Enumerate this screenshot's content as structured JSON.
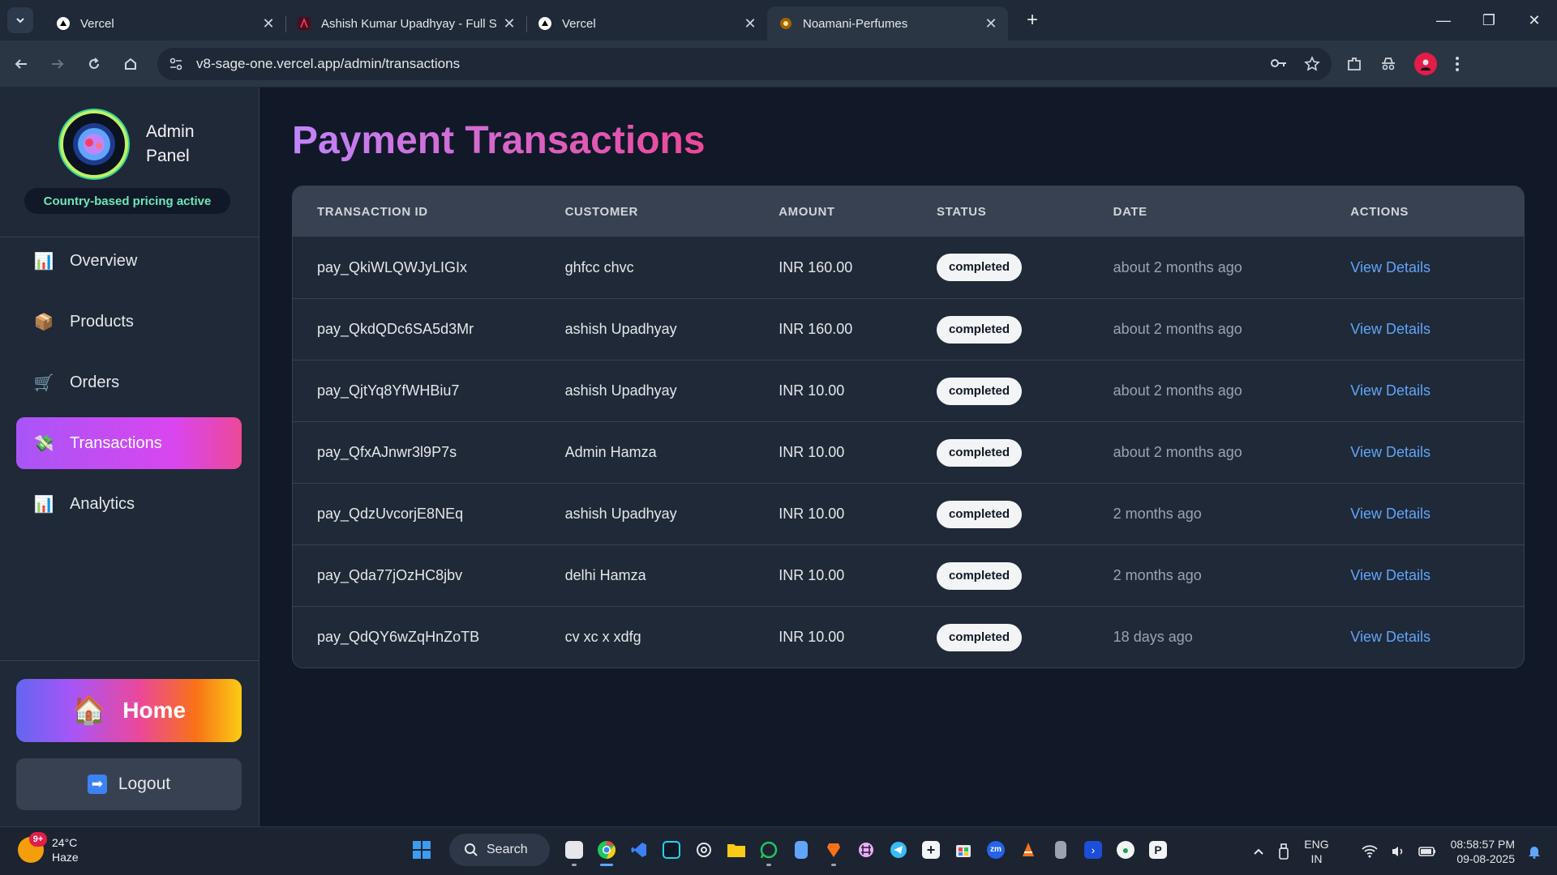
{
  "browser": {
    "tabs": [
      {
        "title": "Vercel",
        "favicon": "vercel-triangle",
        "active": false
      },
      {
        "title": "Ashish Kumar Upadhyay - Full S",
        "favicon": "ak-logo",
        "active": false
      },
      {
        "title": "Vercel",
        "favicon": "vercel-triangle",
        "active": false
      },
      {
        "title": "Noamani-Perfumes",
        "favicon": "perfume-logo",
        "active": true
      }
    ],
    "url": "v8-sage-one.vercel.app/admin/transactions"
  },
  "sidebar": {
    "brand_title": "Admin Panel",
    "pricing_note": "Country-based pricing active",
    "items": [
      {
        "label": "Overview",
        "icon": "bar-chart-icon",
        "glyph": "📊"
      },
      {
        "label": "Products",
        "icon": "package-icon",
        "glyph": "📦"
      },
      {
        "label": "Orders",
        "icon": "cart-icon",
        "glyph": "🛒"
      },
      {
        "label": "Transactions",
        "icon": "money-wings-icon",
        "glyph": "💸"
      },
      {
        "label": "Analytics",
        "icon": "bar-chart-icon",
        "glyph": "📊"
      }
    ],
    "home_label": "Home",
    "home_glyph": "🏠",
    "logout_label": "Logout",
    "logout_glyph": "➡"
  },
  "main": {
    "title": "Payment Transactions",
    "columns": [
      "Transaction ID",
      "Customer",
      "Amount",
      "Status",
      "Date",
      "Actions"
    ],
    "rows": [
      {
        "id": "pay_QkiWLQWJyLIGIx",
        "customer": "ghfcc chvc",
        "amount": "INR 160.00",
        "status": "completed",
        "date": "about 2 months ago",
        "action": "View Details"
      },
      {
        "id": "pay_QkdQDc6SA5d3Mr",
        "customer": "ashish Upadhyay",
        "amount": "INR 160.00",
        "status": "completed",
        "date": "about 2 months ago",
        "action": "View Details"
      },
      {
        "id": "pay_QjtYq8YfWHBiu7",
        "customer": "ashish Upadhyay",
        "amount": "INR 10.00",
        "status": "completed",
        "date": "about 2 months ago",
        "action": "View Details"
      },
      {
        "id": "pay_QfxAJnwr3l9P7s",
        "customer": "Admin Hamza",
        "amount": "INR 10.00",
        "status": "completed",
        "date": "about 2 months ago",
        "action": "View Details"
      },
      {
        "id": "pay_QdzUvcorjE8NEq",
        "customer": "ashish Upadhyay",
        "amount": "INR 10.00",
        "status": "completed",
        "date": "2 months ago",
        "action": "View Details"
      },
      {
        "id": "pay_Qda77jOzHC8jbv",
        "customer": "delhi Hamza",
        "amount": "INR 10.00",
        "status": "completed",
        "date": "2 months ago",
        "action": "View Details"
      },
      {
        "id": "pay_QdQY6wZqHnZoTB",
        "customer": "cv xc x xdfg",
        "amount": "INR 10.00",
        "status": "completed",
        "date": "18 days ago",
        "action": "View Details"
      }
    ]
  },
  "taskbar": {
    "weather_badge": "9+",
    "temperature": "24°C",
    "condition": "Haze",
    "search_label": "Search",
    "apps": [
      {
        "name": "notes-app-icon",
        "color": "#e5e7eb"
      },
      {
        "name": "chrome-icon",
        "color": "#22c55e"
      },
      {
        "name": "vscode-icon",
        "color": "#3b82f6"
      },
      {
        "name": "jetbrains-icon",
        "color": "#111827"
      },
      {
        "name": "chatgpt-icon",
        "color": "#e5e7eb"
      },
      {
        "name": "file-explorer-icon",
        "color": "#facc15"
      },
      {
        "name": "whatsapp-icon",
        "color": "#22c55e"
      },
      {
        "name": "notepad-icon",
        "color": "#60a5fa"
      },
      {
        "name": "brave-icon",
        "color": "#f97316"
      },
      {
        "name": "slack-icon",
        "color": "#e879f9"
      },
      {
        "name": "telegram-icon",
        "color": "#38bdf8"
      },
      {
        "name": "add-app-icon",
        "color": "#f3f4f6"
      },
      {
        "name": "ms-store-icon",
        "color": "#3b82f6"
      },
      {
        "name": "zoom-icon",
        "color": "#2563eb"
      },
      {
        "name": "vlc-icon",
        "color": "#f97316"
      },
      {
        "name": "recycle-icon",
        "color": "#9ca3af"
      },
      {
        "name": "powershell-icon",
        "color": "#1d4ed8"
      },
      {
        "name": "mongodb-icon",
        "color": "#16a34a"
      },
      {
        "name": "terminal-icon",
        "color": "#f3f4f6"
      }
    ],
    "lang_line1": "ENG",
    "lang_line2": "IN",
    "time": "08:58:57 PM",
    "date": "09-08-2025"
  },
  "colors": {
    "accent_purple": "#a855f7",
    "accent_pink": "#ec4899",
    "link_blue": "#60a5fa"
  }
}
